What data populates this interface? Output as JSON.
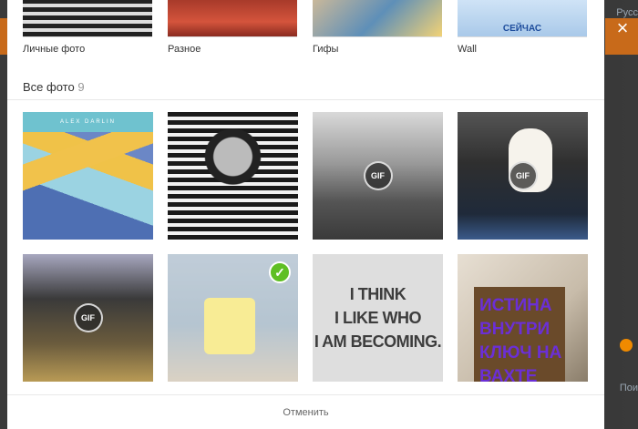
{
  "albums": [
    {
      "name": "Личные фото"
    },
    {
      "name": "Разное"
    },
    {
      "name": "Гифы"
    },
    {
      "name": "Wall",
      "thumb_text": "СЕЙЧАС"
    }
  ],
  "section": {
    "title": "Все фото",
    "count": "9"
  },
  "photos": [
    {
      "id": "p1",
      "banner_text": "ALEX DARLIN"
    },
    {
      "id": "p2"
    },
    {
      "id": "p3",
      "gif": "GIF"
    },
    {
      "id": "p4",
      "gif": "GIF"
    },
    {
      "id": "p5",
      "gif": "GIF"
    },
    {
      "id": "p6",
      "selected": true
    },
    {
      "id": "p7",
      "text_lines": [
        "I THINK",
        "I LIKE WHO",
        "I AM BECOMING."
      ]
    },
    {
      "id": "p8",
      "text_lines": [
        "ИСТИНА",
        "ВНУТРИ",
        "КЛЮЧ НА",
        "ВАХТЕ"
      ]
    }
  ],
  "footer": {
    "cancel_label": "Отменить"
  },
  "background": {
    "right_text_top": "Русс",
    "right_text_bottom": "Пои"
  },
  "close_icon": "×",
  "check_icon": "✓",
  "colors": {
    "selected_check": "#5fbf24",
    "accent_strip": "#c86a1a"
  }
}
